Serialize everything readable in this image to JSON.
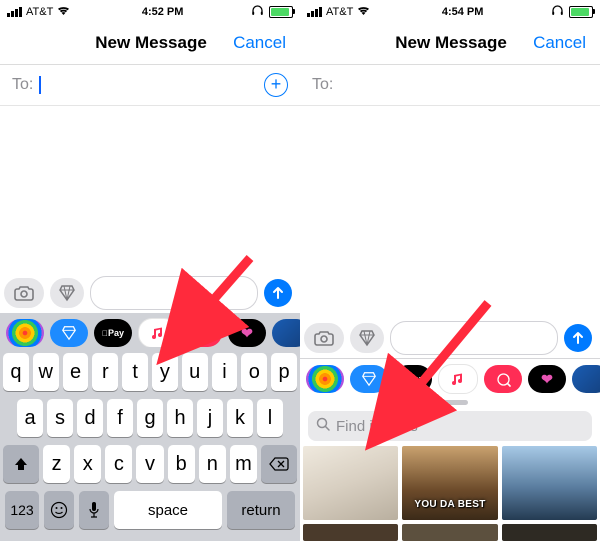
{
  "left": {
    "status": {
      "carrier": "AT&T",
      "time": "4:52 PM"
    },
    "nav": {
      "title": "New Message",
      "cancel": "Cancel"
    },
    "to": {
      "label": "To:"
    },
    "keyboard": {
      "row1": [
        "q",
        "w",
        "e",
        "r",
        "t",
        "y",
        "u",
        "i",
        "o",
        "p"
      ],
      "row2": [
        "a",
        "s",
        "d",
        "f",
        "g",
        "h",
        "j",
        "k",
        "l"
      ],
      "row3": [
        "z",
        "x",
        "c",
        "v",
        "b",
        "n",
        "m"
      ],
      "numKey": "123",
      "spaceKey": "space",
      "returnKey": "return"
    },
    "apps": {
      "pay": "Pay"
    }
  },
  "right": {
    "status": {
      "carrier": "AT&T",
      "time": "4:54 PM"
    },
    "nav": {
      "title": "New Message",
      "cancel": "Cancel"
    },
    "to": {
      "label": "To:"
    },
    "search": {
      "placeholder": "Find images"
    },
    "gif": {
      "caption2": "YOU DA BEST"
    },
    "apps": {
      "pay": "Pay"
    }
  }
}
